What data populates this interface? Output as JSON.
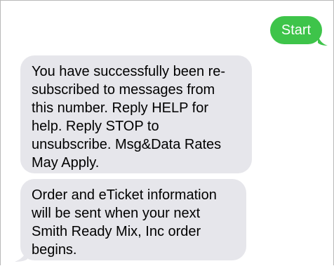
{
  "conversation": {
    "outgoing": [
      {
        "text": "Start",
        "color": "#3ec44a"
      }
    ],
    "incoming": [
      {
        "text": "You have successfully been re-\nsubscribed to messages from\nthis number. Reply HELP for\nhelp. Reply STOP to\nunsubscribe. Msg&Data Rates\nMay Apply.",
        "color": "#e6e6eb"
      },
      {
        "text": "Order and eTicket information\nwill be sent when your next\nSmith Ready Mix, Inc order\nbegins.",
        "color": "#e6e6eb"
      }
    ]
  }
}
